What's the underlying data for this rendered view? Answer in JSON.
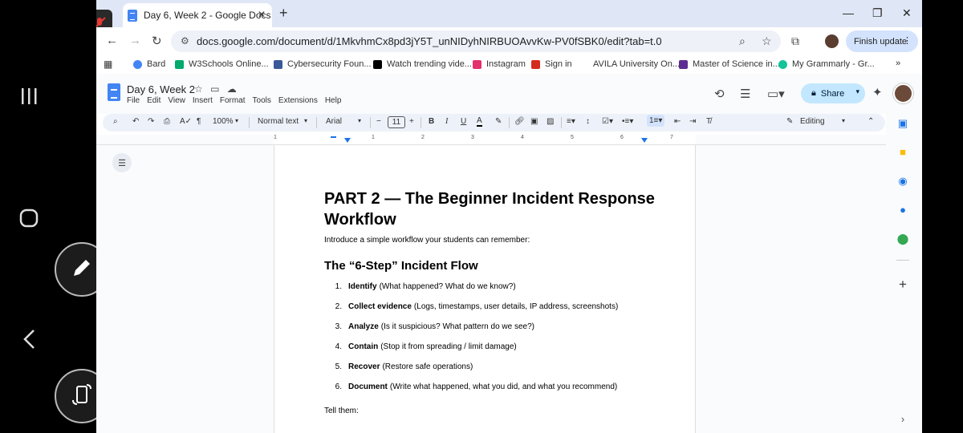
{
  "tab": {
    "title": "Day 6, Week 2 - Google Docs",
    "close": "✕",
    "new_tab": "+"
  },
  "window_controls": {
    "minimize": "—",
    "restore": "❐",
    "close": "✕"
  },
  "address": {
    "url": "docs.google.com/document/d/1MkvhmCx8pd3jY5T_unNIDyhNIRBUOAvvKw-PV0fSBK0/edit?tab=t.0",
    "finish_update": "Finish update"
  },
  "bookmarks": [
    {
      "label": "Bard",
      "color": "#4285f4"
    },
    {
      "label": "W3Schools Online...",
      "color": "#04aa6d"
    },
    {
      "label": "Cybersecurity Foun...",
      "color": "#3b5998"
    },
    {
      "label": "Watch trending vide...",
      "color": "#000000"
    },
    {
      "label": "Instagram",
      "color": "#e1306c"
    },
    {
      "label": "Sign in",
      "color": "#d52b1e"
    },
    {
      "label": "AVILA University On...",
      "color": "#ffffff"
    },
    {
      "label": "Master of Science in...",
      "color": "#ffffff"
    },
    {
      "label": "My Grammarly - Gr...",
      "color": "#15c39a"
    }
  ],
  "docs": {
    "title": "Day 6, Week 2",
    "menu": [
      "File",
      "Edit",
      "View",
      "Insert",
      "Format",
      "Tools",
      "Extensions",
      "Help"
    ],
    "share_label": "Share"
  },
  "toolbar": {
    "zoom": "100%",
    "style": "Normal text",
    "font": "Arial",
    "font_size": "11",
    "minus": "−",
    "plus": "+",
    "mode": "Editing"
  },
  "ruler": {
    "numbers": [
      "1",
      "1",
      "2",
      "3",
      "4",
      "5",
      "6",
      "7"
    ]
  },
  "document": {
    "heading": "PART 2 — The Beginner Incident Response Workflow",
    "intro": "Introduce a simple workflow your students can remember:",
    "subheading": "The “6-Step” Incident Flow",
    "steps": [
      {
        "num": "1.",
        "bold": "Identify",
        "rest": "(What happened? What do we know?)"
      },
      {
        "num": "2.",
        "bold": "Collect evidence",
        "rest": "(Logs, timestamps, user details, IP address, screenshots)"
      },
      {
        "num": "3.",
        "bold": "Analyze",
        "rest": "(Is it suspicious? What pattern do we see?)"
      },
      {
        "num": "4.",
        "bold": "Contain",
        "rest": "(Stop it from spreading / limit damage)"
      },
      {
        "num": "5.",
        "bold": "Recover",
        "rest": "(Restore safe operations)"
      },
      {
        "num": "6.",
        "bold": "Document",
        "rest": "(Write what happened, what you did, and what you recommend)"
      }
    ],
    "tell_them": "Tell them:"
  },
  "colors": {
    "accent": "#4285f4",
    "share_bg": "#c2e7ff",
    "toolbar_bg": "#edf2fa",
    "tab_strip": "#dfe6f5"
  }
}
